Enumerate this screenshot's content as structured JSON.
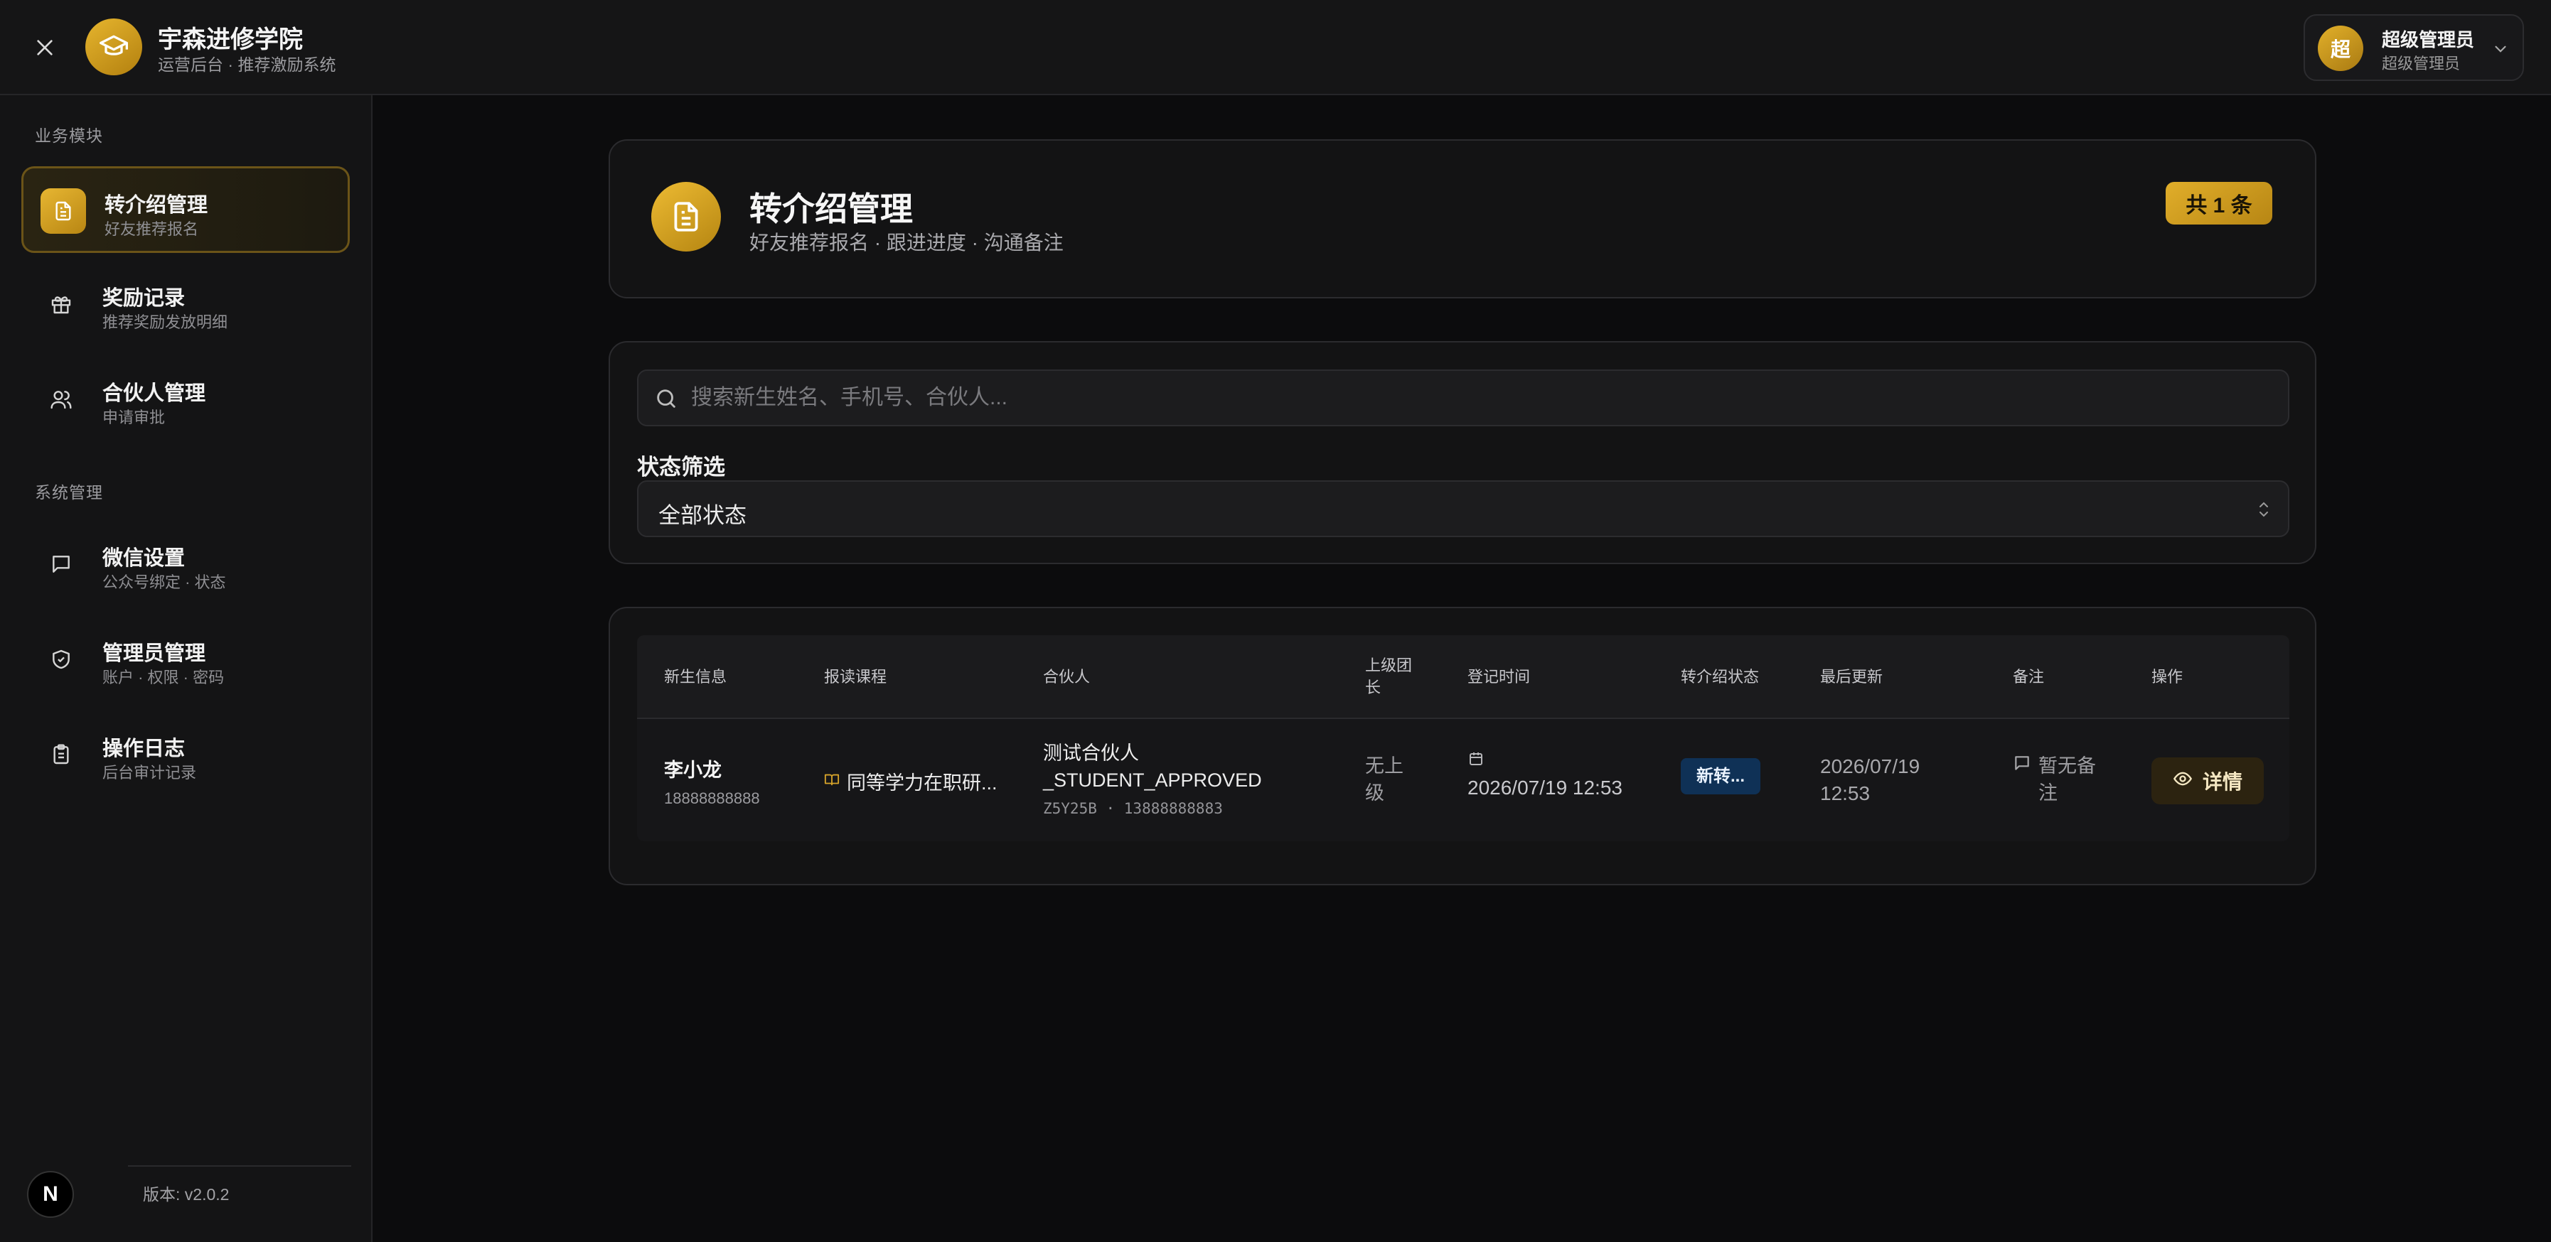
{
  "header": {
    "brand_title": "宇森进修学院",
    "brand_subtitle": "运营后台 · 推荐激励系统",
    "user_initial": "超",
    "user_name": "超级管理员",
    "user_role": "超级管理员"
  },
  "sidebar": {
    "section1": "业务模块",
    "section2": "系统管理",
    "items": [
      {
        "title": "转介绍管理",
        "sub": "好友推荐报名",
        "icon": "document-icon",
        "active": true
      },
      {
        "title": "奖励记录",
        "sub": "推荐奖励发放明细",
        "icon": "gift-icon"
      },
      {
        "title": "合伙人管理",
        "sub": "申请审批",
        "icon": "users-icon"
      },
      {
        "title": "微信设置",
        "sub": "公众号绑定 · 状态",
        "icon": "chat-icon"
      },
      {
        "title": "管理员管理",
        "sub": "账户 · 权限 · 密码",
        "icon": "shield-icon"
      },
      {
        "title": "操作日志",
        "sub": "后台审计记录",
        "icon": "clipboard-icon"
      }
    ],
    "version": "版本: v2.0.2",
    "badge": "N"
  },
  "hero": {
    "title": "转介绍管理",
    "subtitle": "好友推荐报名 · 跟进进度 · 沟通备注",
    "count": "共 1 条"
  },
  "filter": {
    "search_placeholder": "搜索新生姓名、手机号、合伙人...",
    "status_label": "状态筛选",
    "status_value": "全部状态"
  },
  "table": {
    "columns": [
      "新生信息",
      "报读课程",
      "合伙人",
      "上级团长",
      "登记时间",
      "转介绍状态",
      "最后更新",
      "备注",
      "操作"
    ],
    "rows": [
      {
        "student_name": "李小龙",
        "student_phone": "18888888888",
        "course": "同等学力在职研...",
        "partner_name": "测试合伙人_STUDENT_APPROVED",
        "partner_meta": "Z5Y25B · 13888888883",
        "leader": "无上级",
        "reg_time": "2026/07/19 12:53",
        "status": "新转...",
        "updated": "2026/07/19 12:53",
        "note": "暂无备注",
        "action": "详情"
      }
    ]
  },
  "colors": {
    "accent_gold": "#e1ae2a",
    "status_blue": "#0f3156",
    "background": "#0c0c0d"
  }
}
